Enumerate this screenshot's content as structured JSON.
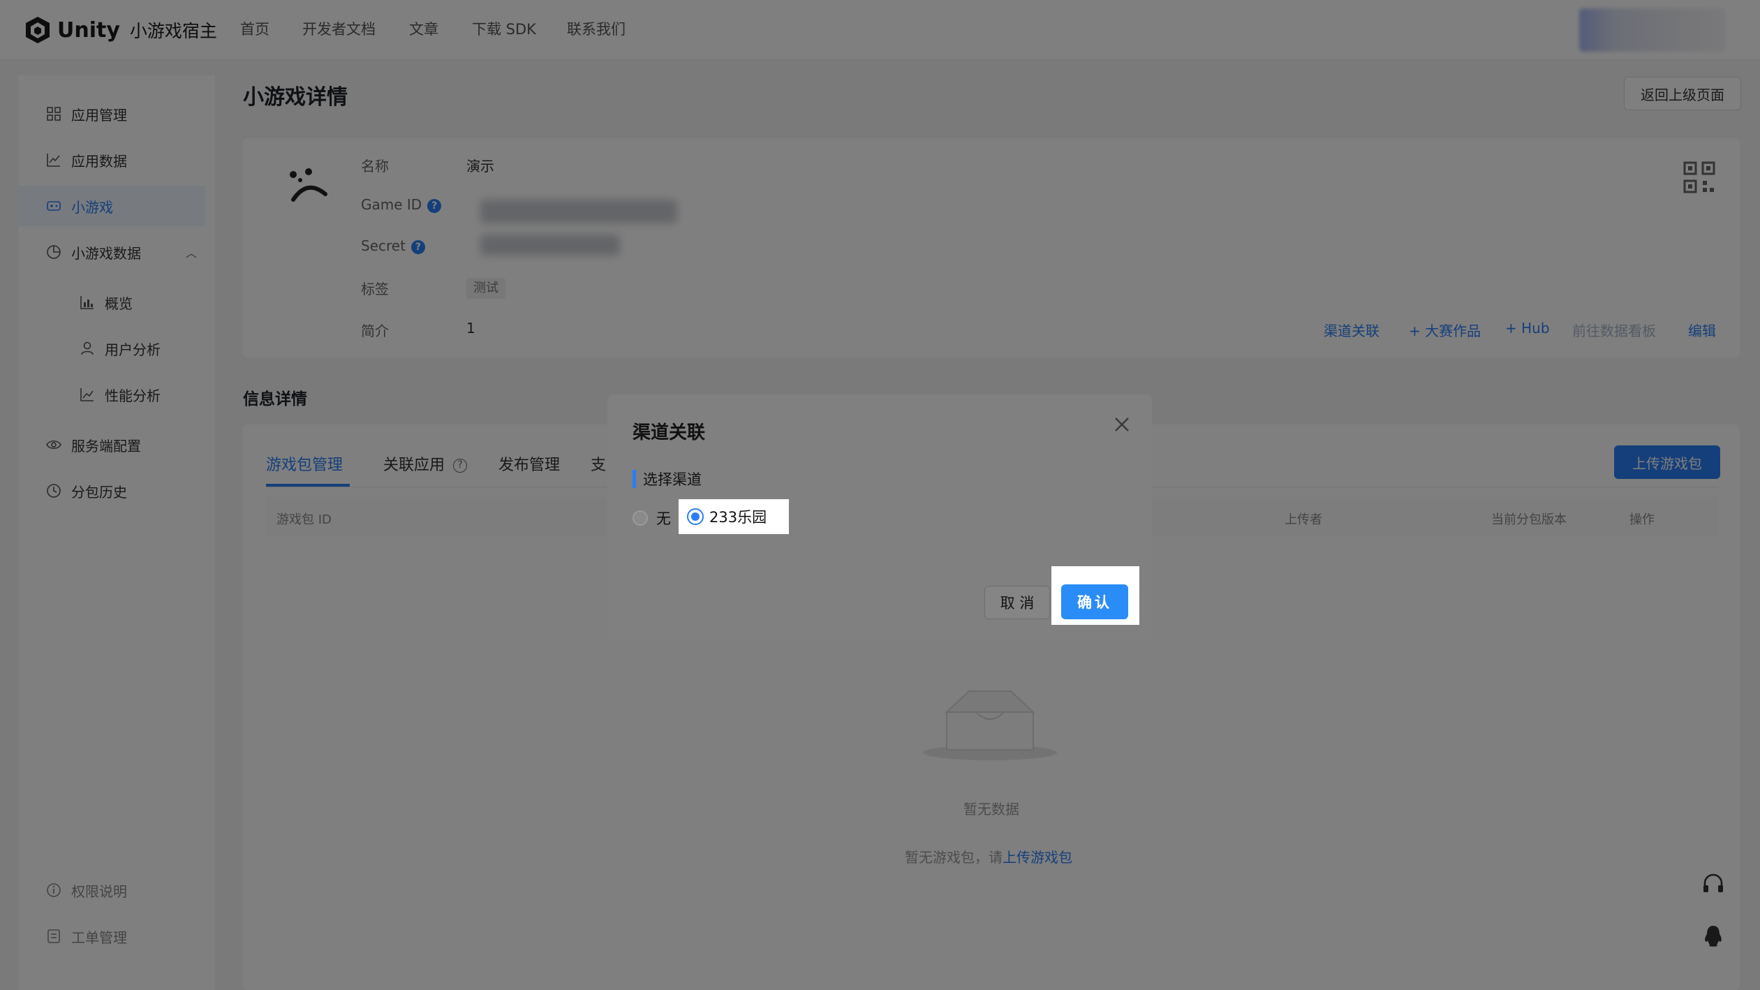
{
  "header": {
    "brand": "Unity",
    "product": "小游戏宿主",
    "nav": [
      "首页",
      "开发者文档",
      "文章",
      "下载 SDK",
      "联系我们"
    ]
  },
  "sidebar": {
    "items": [
      {
        "label": "应用管理",
        "icon": "grid-icon"
      },
      {
        "label": "应用数据",
        "icon": "line-chart-icon"
      },
      {
        "label": "小游戏",
        "icon": "gamepad-icon",
        "active": true
      },
      {
        "label": "小游戏数据",
        "icon": "pie-chart-icon",
        "expanded": true
      },
      {
        "label": "概览",
        "icon": "bar-chart-icon"
      },
      {
        "label": "用户分析",
        "icon": "user-icon"
      },
      {
        "label": "性能分析",
        "icon": "trend-icon"
      },
      {
        "label": "服务端配置",
        "icon": "eye-icon"
      },
      {
        "label": "分包历史",
        "icon": "clock-icon"
      }
    ],
    "bottom": [
      {
        "label": "权限说明",
        "icon": "info-icon"
      },
      {
        "label": "工单管理",
        "icon": "ticket-icon"
      }
    ]
  },
  "page": {
    "title": "小游戏详情",
    "back_label": "返回上级页面"
  },
  "game": {
    "fields": {
      "name_label": "名称",
      "name_value": "演示",
      "gameid_label": "Game ID",
      "secret_label": "Secret",
      "tag_label": "标签",
      "tag_value": "测试",
      "intro_label": "简介",
      "intro_value": "1"
    },
    "actions": [
      "渠道关联",
      "+ 大赛作品",
      "+ Hub",
      "前往数据看板",
      "编辑"
    ]
  },
  "info": {
    "title": "信息详情",
    "tabs": [
      "游戏包管理",
      "关联应用",
      "发布管理",
      "支"
    ],
    "upload_label": "上传游戏包",
    "columns": [
      "游戏包 ID",
      "上传者",
      "当前分包版本",
      "操作"
    ],
    "empty_text": "暂无数据",
    "empty_hint": "暂无游戏包，请",
    "empty_link": "上传游戏包"
  },
  "dialog": {
    "title": "渠道关联",
    "section": "选择渠道",
    "options": [
      {
        "label": "无",
        "selected": false
      },
      {
        "label": "233乐园",
        "selected": true
      }
    ],
    "cancel_label": "取 消",
    "confirm_label": "确认"
  },
  "colors": {
    "accent": "#2a7ef5",
    "overlay": "rgba(0,0,0,0.5)"
  }
}
